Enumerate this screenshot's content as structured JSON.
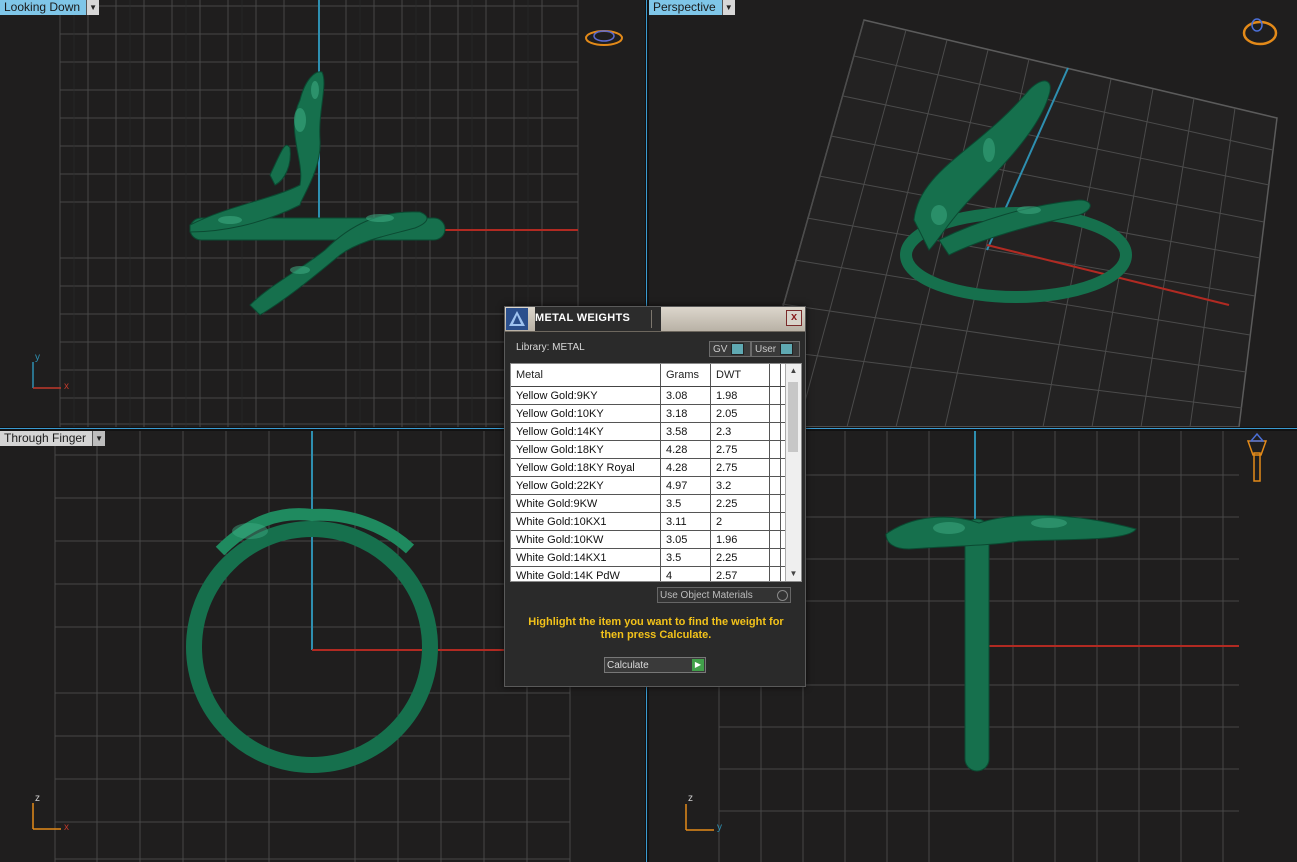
{
  "viewports": {
    "top": {
      "label": "Looking Down",
      "axis_v": "y",
      "axis_h": "x"
    },
    "perspective": {
      "label": "Perspective"
    },
    "front": {
      "label": "Through Finger",
      "axis_v": "z",
      "axis_h": "x"
    },
    "side": {
      "label": "",
      "axis_v": "z",
      "axis_h": "y"
    }
  },
  "dialog": {
    "title": "METAL WEIGHTS",
    "close": "x",
    "library_label": "Library: METAL",
    "toggle_gv": "GV",
    "toggle_user": "User",
    "columns": [
      "Metal",
      "Grams",
      "DWT"
    ],
    "rows": [
      [
        "Yellow Gold:9KY",
        "3.08",
        "1.98"
      ],
      [
        "Yellow Gold:10KY",
        "3.18",
        "2.05"
      ],
      [
        "Yellow Gold:14KY",
        "3.58",
        "2.3"
      ],
      [
        "Yellow Gold:18KY",
        "4.28",
        "2.75"
      ],
      [
        "Yellow Gold:18KY Royal",
        "4.28",
        "2.75"
      ],
      [
        "Yellow Gold:22KY",
        "4.97",
        "3.2"
      ],
      [
        "White Gold:9KW",
        "3.5",
        "2.25"
      ],
      [
        "White Gold:10KX1",
        "3.11",
        "2"
      ],
      [
        "White Gold:10KW",
        "3.05",
        "1.96"
      ],
      [
        "White Gold:14KX1",
        "3.5",
        "2.25"
      ],
      [
        "White Gold:14K PdW",
        "4",
        "2.57"
      ]
    ],
    "use_object_materials": "Use Object Materials",
    "hint": "Highlight the item you want to find the weight for then press Calculate.",
    "calculate": "Calculate"
  },
  "colors": {
    "model": "#1a7a55",
    "grid": "#4a4a4a",
    "x_axis": "#c0392b",
    "y_axis": "#2e8fb0"
  }
}
